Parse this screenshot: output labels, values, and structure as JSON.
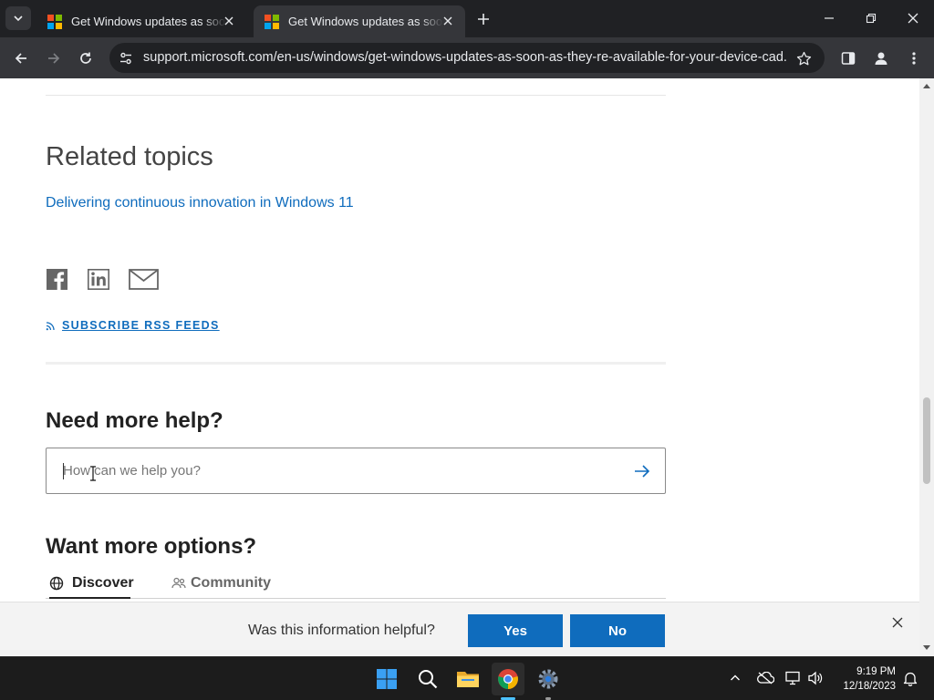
{
  "browser": {
    "tabs": [
      {
        "title": "Get Windows updates as soon as they're available",
        "active": false
      },
      {
        "title": "Get Windows updates as soon as they're available",
        "active": true
      }
    ],
    "url": "support.microsoft.com/en-us/windows/get-windows-updates-as-soon-as-they-re-available-for-your-device-cad..."
  },
  "page": {
    "related_title": "Related topics",
    "related_link": "Delivering continuous innovation in Windows 11",
    "rss_label": "SUBSCRIBE RSS FEEDS",
    "need_help_title": "Need more help?",
    "search_placeholder": "How can we help you?",
    "more_options_title": "Want more options?",
    "option_tabs": [
      {
        "label": "Discover",
        "icon": "globe-icon",
        "selected": true
      },
      {
        "label": "Community",
        "icon": "people-icon",
        "selected": false
      }
    ]
  },
  "feedback": {
    "question": "Was this information helpful?",
    "yes_label": "Yes",
    "no_label": "No"
  },
  "taskbar": {
    "time": "9:19 PM",
    "date": "12/18/2023"
  },
  "colors": {
    "accent": "#0f6cbd",
    "chrome_dark": "#202124",
    "chrome_toolbar": "#35363a",
    "taskbar": "#1c1c1c"
  }
}
